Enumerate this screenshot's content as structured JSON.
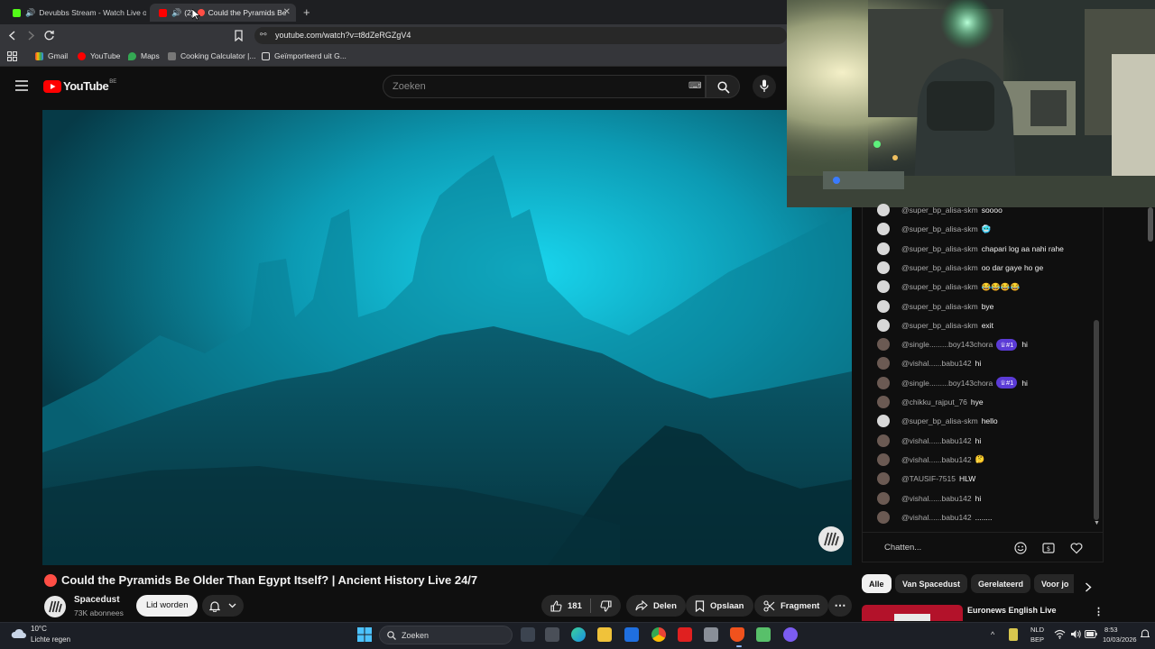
{
  "tabs": [
    {
      "label": "Devubbs Stream - Watch Live on"
    },
    {
      "label": "(2)",
      "title": "Could the Pyramids Be"
    }
  ],
  "new_tab": "+",
  "address": {
    "url": "youtube.com/watch?v=t8dZeRGZgV4"
  },
  "bookmarks": [
    "Gmail",
    "YouTube",
    "Maps",
    "Cooking Calculator |...",
    "Geïmporteerd uit G..."
  ],
  "youtube": {
    "logo": "YouTube",
    "region": "BE",
    "search_placeholder": "Zoeken"
  },
  "video": {
    "title": "Could the Pyramids Be Older Than Egypt Itself? | Ancient History Live 24/7"
  },
  "channel": {
    "name": "Spacedust",
    "subs": "73K abonnees",
    "join": "Lid worden"
  },
  "actions": {
    "likes": "181",
    "share": "Delen",
    "save": "Opslaan",
    "clip": "Fragment"
  },
  "chips": [
    "Alle",
    "Van Spacedust",
    "Gerelateerd",
    "Voor jo"
  ],
  "related": {
    "title": "Euronews English Live"
  },
  "chat": {
    "placeholder": "Chatten...",
    "messages": [
      {
        "author": "@super_bp_alisa-skm",
        "text": "soooo",
        "avatar": "light"
      },
      {
        "author": "@super_bp_alisa-skm",
        "text": "🥶",
        "avatar": "light"
      },
      {
        "author": "@super_bp_alisa-skm",
        "text": "chapari log aa nahi rahe",
        "avatar": "light"
      },
      {
        "author": "@super_bp_alisa-skm",
        "text": "oo dar gaye ho ge",
        "avatar": "light"
      },
      {
        "author": "@super_bp_alisa-skm",
        "text": "😂😂😂😂",
        "avatar": "light"
      },
      {
        "author": "@super_bp_alisa-skm",
        "text": "bye",
        "avatar": "light"
      },
      {
        "author": "@super_bp_alisa-skm",
        "text": "exit",
        "avatar": "light"
      },
      {
        "author": "@single.........boy143chora",
        "badge": "♕#1",
        "text": "hi",
        "avatar": "dark"
      },
      {
        "author": "@vishal......babu142",
        "text": "hi",
        "avatar": "dark"
      },
      {
        "author": "@single.........boy143chora",
        "badge": "♕#1",
        "text": "hi",
        "avatar": "dark"
      },
      {
        "author": "@chikku_rajput_76",
        "text": "hye",
        "avatar": "dark"
      },
      {
        "author": "@super_bp_alisa-skm",
        "text": "hello",
        "avatar": "light"
      },
      {
        "author": "@vishal......babu142",
        "text": "hi",
        "avatar": "dark"
      },
      {
        "author": "@vishal......babu142",
        "text": "🤔",
        "avatar": "dark"
      },
      {
        "author": "@TAUSIF-7515",
        "text": "HLW",
        "avatar": "dark"
      },
      {
        "author": "@vishal......babu142",
        "text": "hi",
        "avatar": "dark"
      },
      {
        "author": "@vishal......babu142",
        "text": "........",
        "avatar": "dark"
      }
    ]
  },
  "taskbar": {
    "weather_temp": "10°C",
    "weather_desc": "Lichte regen",
    "search": "Zoeken",
    "lang": "NLD",
    "lang2": "BEP",
    "time": "8:53",
    "date": "10/03/2026"
  },
  "colors": {
    "bg": "#0f0f0f",
    "yt_red": "#ff0000",
    "video_teal": "#0fb3c9",
    "badge_purple": "#5b3bd6"
  }
}
